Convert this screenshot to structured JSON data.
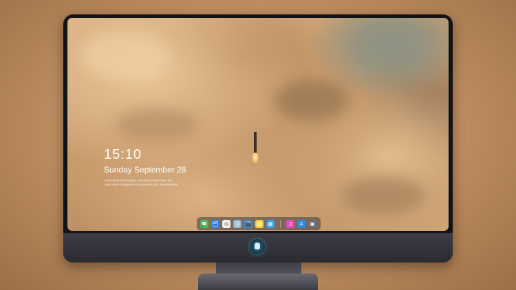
{
  "lockscreen": {
    "time": "15:10",
    "date": "Sunday September 28",
    "tagline_line1": "Interesting technology. Amazing productivity. My...",
    "tagline_line2": "your ideal companion for a smarter life. bsoo666888"
  },
  "dock": {
    "apps": [
      {
        "name": "messages-icon",
        "glyph": "💬",
        "color": "#3cc24d"
      },
      {
        "name": "files-icon",
        "glyph": "🗂",
        "color": "#2f7fe0"
      },
      {
        "name": "clock-icon",
        "glyph": "◷",
        "color": "#f2f2f2"
      },
      {
        "name": "preview-icon",
        "glyph": "🖼",
        "color": "#8ab3d6"
      },
      {
        "name": "clapper-icon",
        "glyph": "🎬",
        "color": "#2e8fd8"
      },
      {
        "name": "notes-icon",
        "glyph": "▤",
        "color": "#f5d34a"
      },
      {
        "name": "photos-icon",
        "glyph": "▦",
        "color": "#3fa0e8"
      },
      {
        "name": "music-icon",
        "glyph": "♫",
        "color": "#e04fb8"
      },
      {
        "name": "app-store-icon",
        "glyph": "A",
        "color": "#2e88e8"
      },
      {
        "name": "camera-icon",
        "glyph": "▣",
        "color": "#6d6d72"
      }
    ]
  },
  "colors": {
    "sky": "#8d9283",
    "cloud_light": "#e9c497",
    "cloud_dark": "#9c7a5c",
    "bezel": "#121317",
    "chin": "#3c3c44"
  }
}
